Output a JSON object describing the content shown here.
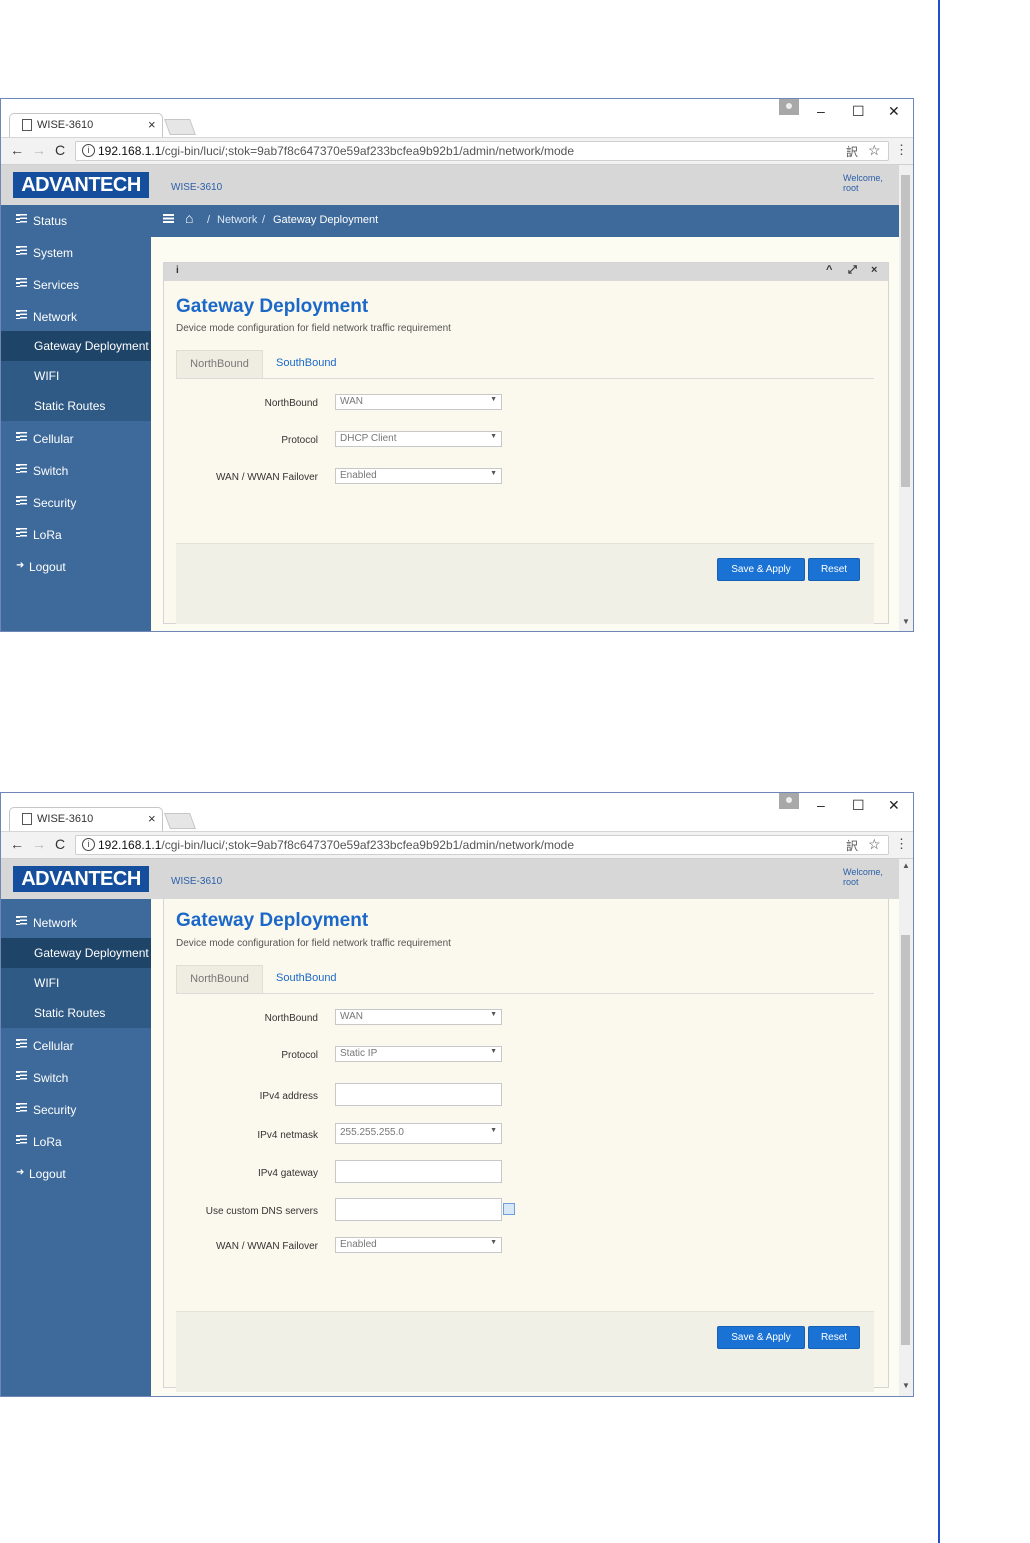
{
  "browser": {
    "tab_title": "WISE-3610",
    "tab_close": "×",
    "url_host": "192.168.1.1",
    "url_path": "/cgi-bin/luci/;stok=9ab7f8c647370e59af233bcfea9b92b1/admin/network/mode",
    "back": "←",
    "forward": "→",
    "reload": "C",
    "info": "i",
    "translate": "訳",
    "star": "☆",
    "menu": "⋮",
    "minimize": "–",
    "maximize": "☐",
    "close": "✕"
  },
  "app": {
    "logo": "ADVANTECH",
    "product": "WISE-3610",
    "welcome_line1": "Welcome,",
    "welcome_line2": "root"
  },
  "sidebar": {
    "status": "Status",
    "system": "System",
    "services": "Services",
    "network": "Network",
    "gateway_deployment": "Gateway Deployment",
    "wifi": "WIFI",
    "static_routes": "Static Routes",
    "cellular": "Cellular",
    "switch": "Switch",
    "security": "Security",
    "lora": "LoRa",
    "logout": "Logout"
  },
  "breadcrumb": {
    "home_icon": "⌂",
    "separator": "/",
    "network": "Network",
    "current": "Gateway Deployment"
  },
  "panel": {
    "info_icon": "i",
    "collapse": "^",
    "expand": "⤢",
    "close": "×"
  },
  "page": {
    "title": "Gateway Deployment",
    "subtitle": "Device mode configuration for field network traffic requirement",
    "tab_northbound": "NorthBound",
    "tab_southbound": "SouthBound"
  },
  "form1": {
    "northbound_label": "NorthBound",
    "northbound_value": "WAN",
    "protocol_label": "Protocol",
    "protocol_value": "DHCP Client",
    "failover_label": "WAN / WWAN Failover",
    "failover_value": "Enabled"
  },
  "form2": {
    "northbound_label": "NorthBound",
    "northbound_value": "WAN",
    "protocol_label": "Protocol",
    "protocol_value": "Static IP",
    "ipv4_address_label": "IPv4 address",
    "ipv4_address_value": "",
    "ipv4_netmask_label": "IPv4 netmask",
    "ipv4_netmask_value": "255.255.255.0",
    "ipv4_gateway_label": "IPv4 gateway",
    "ipv4_gateway_value": "",
    "dns_label": "Use custom DNS servers",
    "dns_value": "",
    "failover_label": "WAN / WWAN Failover",
    "failover_value": "Enabled"
  },
  "buttons": {
    "save_apply": "Save & Apply",
    "reset": "Reset"
  },
  "colors": {
    "sidebar": "#3d6a9a",
    "sidebar_active": "#1e4468",
    "accent": "#1b68c8",
    "button": "#1a73d4",
    "logo_bg": "#144e9c"
  }
}
